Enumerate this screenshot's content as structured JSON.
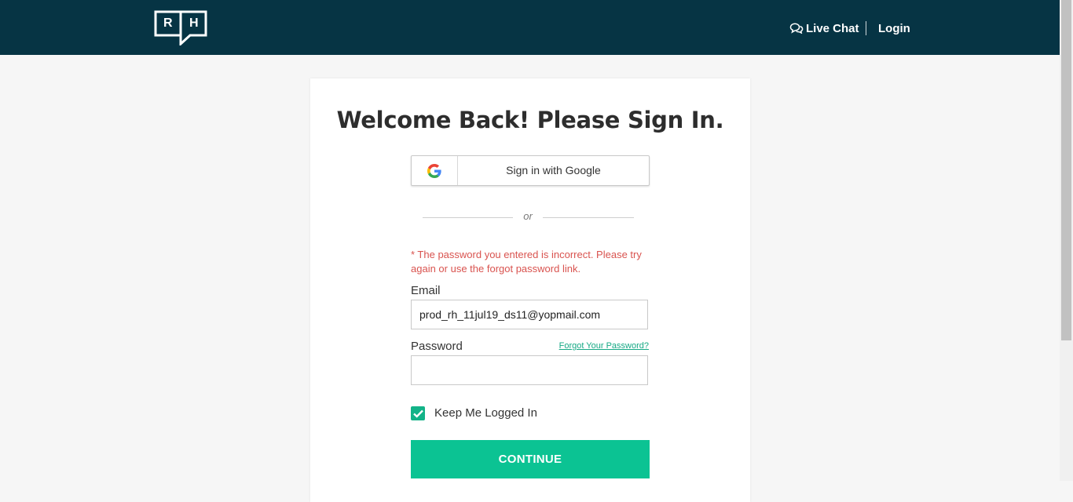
{
  "header": {
    "logo_left": "R",
    "logo_right": "H",
    "live_chat": "Live Chat",
    "login": "Login"
  },
  "signin": {
    "title": "Welcome Back! Please Sign In.",
    "google_button": "Sign in with Google",
    "divider": "or",
    "error": "* The password you entered is incorrect. Please try again or use the forgot password link.",
    "email_label": "Email",
    "email_value": "prod_rh_11jul19_ds11@yopmail.com",
    "password_label": "Password",
    "forgot_link": "Forgot Your Password?",
    "password_value": "",
    "keep_logged_in": "Keep Me Logged In",
    "keep_logged_in_checked": true,
    "continue_button": "CONTINUE"
  },
  "icons": {
    "chat": "chat-bubbles-icon",
    "google": "google-g-icon",
    "check": "checkmark-icon"
  },
  "colors": {
    "header_bg": "#063444",
    "accent": "#0bc393",
    "error": "#d9534f",
    "link": "#16a985"
  }
}
